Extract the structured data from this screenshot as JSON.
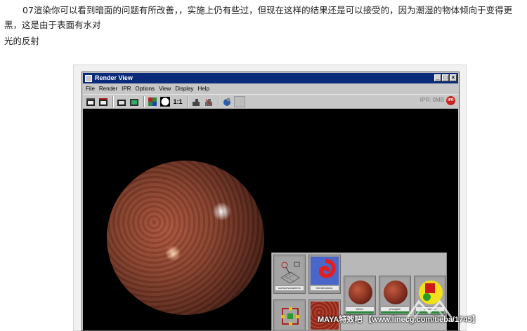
{
  "article": {
    "line1": "07渲染你可以看到暗面的问题有所改善，，实施上仍有些过，但现在这样的结果还是可以接受的，因为潮湿的物体倾向于变得更黑，这是由于表面有水对",
    "line2": "光的反射"
  },
  "window": {
    "title": "Render View",
    "menu": [
      "File",
      "Render",
      "IPR",
      "Options",
      "View",
      "Display",
      "Help"
    ],
    "toolbar": {
      "ratio_label": "1:1",
      "ipr_status": "IPR: 0MB",
      "ipr_badge": "IPR"
    }
  },
  "hypershade": {
    "swatches": [
      {
        "label": "surfaceVarianteh1"
      },
      {
        "label": "blendColors1"
      },
      {
        "label": "blinn1"
      },
      {
        "label": "phong63"
      },
      {
        "label": "phong5E2"
      }
    ]
  },
  "watermark": {
    "text": "MAYA特效吧 【www.linecg.com/tieba/1745】"
  },
  "colors": {
    "titlebar": "#0a2a7a",
    "ipr_badge": "#c8241c",
    "swatch_bar": "#2a8a3a"
  }
}
